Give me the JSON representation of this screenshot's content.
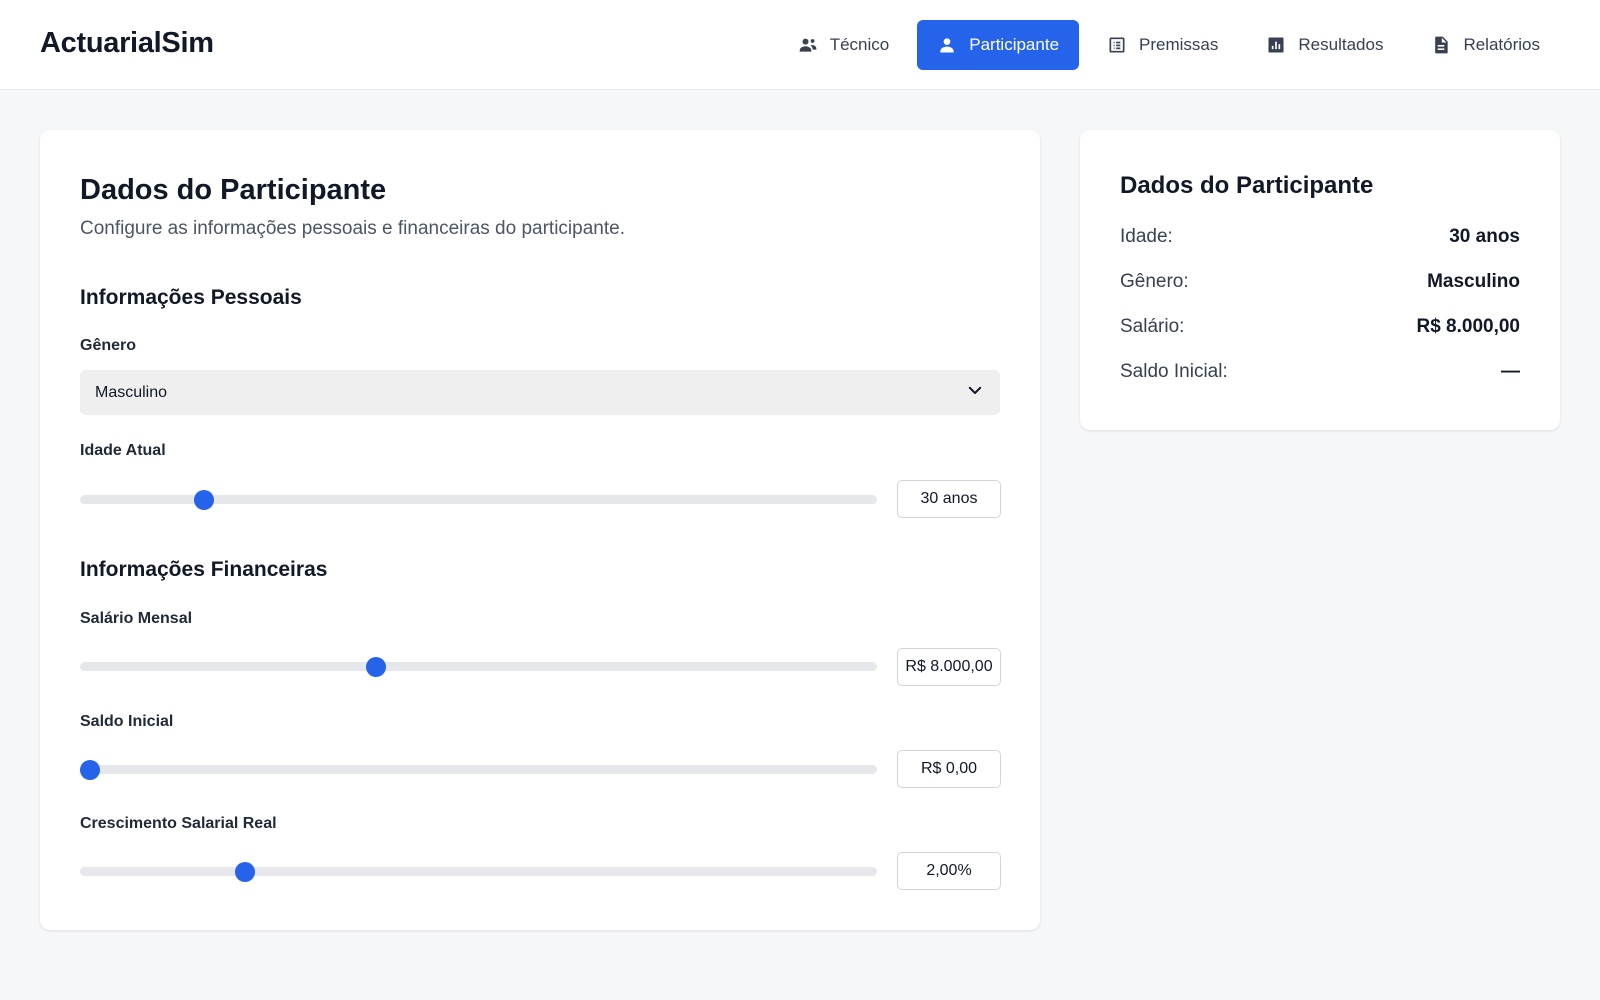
{
  "app": {
    "title": "ActuarialSim"
  },
  "nav": {
    "items": [
      {
        "label": "Técnico",
        "icon": "users-icon",
        "active": false
      },
      {
        "label": "Participante",
        "icon": "person-icon",
        "active": true
      },
      {
        "label": "Premissas",
        "icon": "list-icon",
        "active": false
      },
      {
        "label": "Resultados",
        "icon": "bar-chart-icon",
        "active": false
      },
      {
        "label": "Relatórios",
        "icon": "document-icon",
        "active": false
      }
    ]
  },
  "main": {
    "title": "Dados do Participante",
    "subtitle": "Configure as informações pessoais e financeiras do participante.",
    "personal": {
      "title": "Informações Pessoais",
      "gender": {
        "label": "Gênero",
        "value": "Masculino"
      },
      "age": {
        "label": "Idade Atual",
        "value": "30 anos",
        "level": 0.155
      }
    },
    "financial": {
      "title": "Informações Financeiras",
      "salary": {
        "label": "Salário Mensal",
        "value": "R$ 8.000,00",
        "level": 0.372
      },
      "initial_balance": {
        "label": "Saldo Inicial",
        "value": "R$ 0,00",
        "level": 0.012
      },
      "salary_growth": {
        "label": "Crescimento Salarial Real",
        "value": "2,00%",
        "level": 0.207
      }
    }
  },
  "summary": {
    "title": "Dados do Participante",
    "rows": [
      {
        "label": "Idade:",
        "value": "30 anos"
      },
      {
        "label": "Gênero:",
        "value": "Masculino"
      },
      {
        "label": "Salário:",
        "value": "R$ 8.000,00"
      },
      {
        "label": "Saldo Inicial:",
        "value": "—"
      }
    ]
  },
  "colors": {
    "accent": "#2563eb",
    "background": "#f6f7f9",
    "track": "#e5e7eb"
  }
}
